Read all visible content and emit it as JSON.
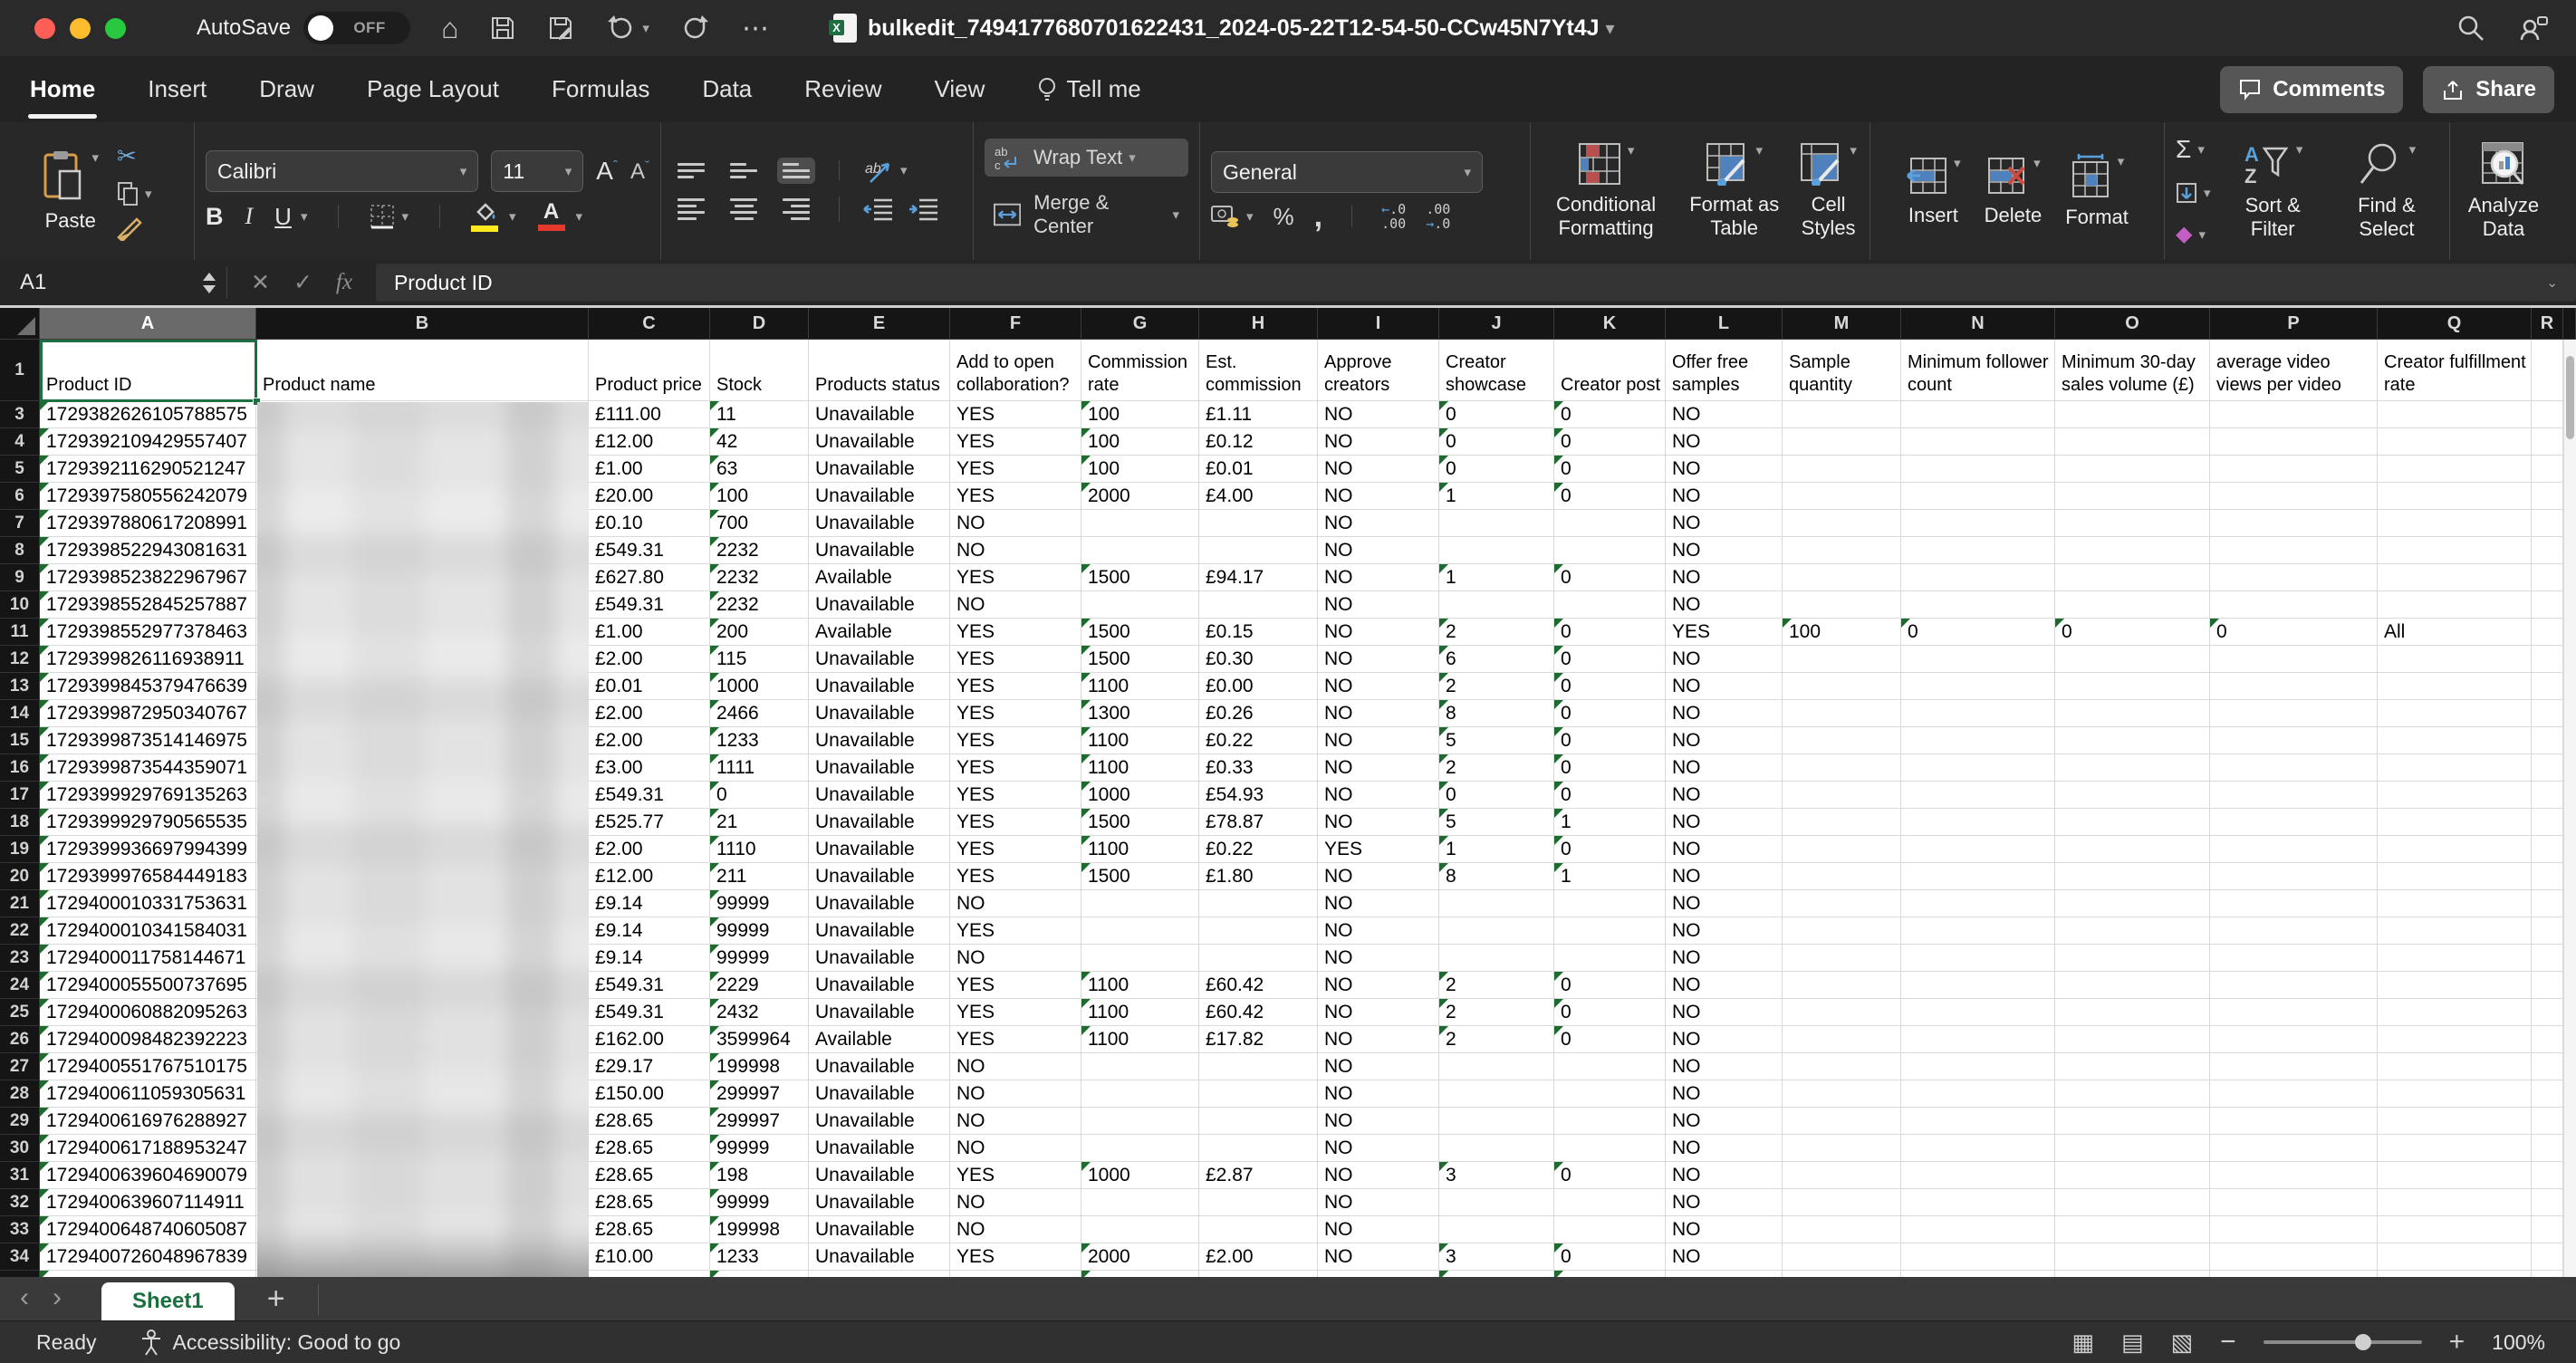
{
  "titlebar": {
    "autosave_label": "AutoSave",
    "autosave_state": "OFF",
    "filename": "bulkedit_7494177680701622431_2024-05-22T12-54-50-CCw45N7Yt4J"
  },
  "tabs": [
    {
      "label": "Home"
    },
    {
      "label": "Insert"
    },
    {
      "label": "Draw"
    },
    {
      "label": "Page Layout"
    },
    {
      "label": "Formulas"
    },
    {
      "label": "Data"
    },
    {
      "label": "Review"
    },
    {
      "label": "View"
    },
    {
      "label": "Tell me"
    }
  ],
  "actions": {
    "comments": "Comments",
    "share": "Share"
  },
  "ribbon": {
    "paste": "Paste",
    "font_name": "Calibri",
    "font_size": "11",
    "wrap_text": "Wrap Text",
    "merge_center": "Merge & Center",
    "number_format": "General",
    "conditional_formatting": "Conditional Formatting",
    "format_as_table": "Format as Table",
    "cell_styles": "Cell Styles",
    "insert": "Insert",
    "delete": "Delete",
    "format": "Format",
    "sort_filter": "Sort & Filter",
    "find_select": "Find & Select",
    "analyze_data": "Analyze Data"
  },
  "formula_bar": {
    "name_box": "A1",
    "content": "Product ID"
  },
  "sheet": {
    "selected_cell": "A1",
    "column_letters": [
      "A",
      "B",
      "C",
      "D",
      "E",
      "F",
      "G",
      "H",
      "I",
      "J",
      "K",
      "L",
      "M",
      "N",
      "O",
      "P",
      "Q",
      "R"
    ],
    "header_row_number": "1",
    "headers": [
      "Product ID",
      "Product name",
      "Product price",
      "Stock",
      "Products status",
      "Add to open collaboration?",
      "Commission rate",
      "Est. commission",
      "Approve creators",
      "Creator showcase",
      "Creator post",
      "Offer free samples",
      "Sample quantity",
      "Minimum follower count",
      "Minimum 30-day sales volume (£)",
      "average video views per video",
      "Creator fulfillment rate"
    ],
    "rows": [
      {
        "n": "3",
        "cells": [
          "1729382626105788575",
          "",
          "£111.00",
          "11",
          "Unavailable",
          "YES",
          "100",
          "£1.11",
          "NO",
          "0",
          "0",
          "NO",
          "",
          "",
          "",
          "",
          ""
        ]
      },
      {
        "n": "4",
        "cells": [
          "1729392109429557407",
          "",
          "£12.00",
          "42",
          "Unavailable",
          "YES",
          "100",
          "£0.12",
          "NO",
          "0",
          "0",
          "NO",
          "",
          "",
          "",
          "",
          ""
        ]
      },
      {
        "n": "5",
        "cells": [
          "1729392116290521247",
          "",
          "£1.00",
          "63",
          "Unavailable",
          "YES",
          "100",
          "£0.01",
          "NO",
          "0",
          "0",
          "NO",
          "",
          "",
          "",
          "",
          ""
        ]
      },
      {
        "n": "6",
        "cells": [
          "1729397580556242079",
          "",
          "£20.00",
          "100",
          "Unavailable",
          "YES",
          "2000",
          "£4.00",
          "NO",
          "1",
          "0",
          "NO",
          "",
          "",
          "",
          "",
          ""
        ]
      },
      {
        "n": "7",
        "cells": [
          "1729397880617208991",
          "",
          "£0.10",
          "700",
          "Unavailable",
          "NO",
          "",
          "",
          "NO",
          "",
          "",
          "NO",
          "",
          "",
          "",
          "",
          ""
        ]
      },
      {
        "n": "8",
        "cells": [
          "1729398522943081631",
          "",
          "£549.31",
          "2232",
          "Unavailable",
          "NO",
          "",
          "",
          "NO",
          "",
          "",
          "NO",
          "",
          "",
          "",
          "",
          ""
        ]
      },
      {
        "n": "9",
        "cells": [
          "1729398523822967967",
          "",
          "£627.80",
          "2232",
          "Available",
          "YES",
          "1500",
          "£94.17",
          "NO",
          "1",
          "0",
          "NO",
          "",
          "",
          "",
          "",
          ""
        ]
      },
      {
        "n": "10",
        "cells": [
          "1729398552845257887",
          "",
          "£549.31",
          "2232",
          "Unavailable",
          "NO",
          "",
          "",
          "NO",
          "",
          "",
          "NO",
          "",
          "",
          "",
          "",
          ""
        ]
      },
      {
        "n": "11",
        "cells": [
          "1729398552977378463",
          "",
          "£1.00",
          "200",
          "Available",
          "YES",
          "1500",
          "£0.15",
          "NO",
          "2",
          "0",
          "YES",
          "100",
          "0",
          "0",
          "0",
          "All"
        ]
      },
      {
        "n": "12",
        "cells": [
          "1729399826116938911",
          "",
          "£2.00",
          "115",
          "Unavailable",
          "YES",
          "1500",
          "£0.30",
          "NO",
          "6",
          "0",
          "NO",
          "",
          "",
          "",
          "",
          ""
        ]
      },
      {
        "n": "13",
        "cells": [
          "1729399845379476639",
          "",
          "£0.01",
          "1000",
          "Unavailable",
          "YES",
          "1100",
          "£0.00",
          "NO",
          "2",
          "0",
          "NO",
          "",
          "",
          "",
          "",
          ""
        ]
      },
      {
        "n": "14",
        "cells": [
          "1729399872950340767",
          "",
          "£2.00",
          "2466",
          "Unavailable",
          "YES",
          "1300",
          "£0.26",
          "NO",
          "8",
          "0",
          "NO",
          "",
          "",
          "",
          "",
          ""
        ]
      },
      {
        "n": "15",
        "cells": [
          "1729399873514146975",
          "",
          "£2.00",
          "1233",
          "Unavailable",
          "YES",
          "1100",
          "£0.22",
          "NO",
          "5",
          "0",
          "NO",
          "",
          "",
          "",
          "",
          ""
        ]
      },
      {
        "n": "16",
        "cells": [
          "1729399873544359071",
          "",
          "£3.00",
          "1111",
          "Unavailable",
          "YES",
          "1100",
          "£0.33",
          "NO",
          "2",
          "0",
          "NO",
          "",
          "",
          "",
          "",
          ""
        ]
      },
      {
        "n": "17",
        "cells": [
          "1729399929769135263",
          "",
          "£549.31",
          "0",
          "Unavailable",
          "YES",
          "1000",
          "£54.93",
          "NO",
          "0",
          "0",
          "NO",
          "",
          "",
          "",
          "",
          ""
        ]
      },
      {
        "n": "18",
        "cells": [
          "1729399929790565535",
          "",
          "£525.77",
          "21",
          "Unavailable",
          "YES",
          "1500",
          "£78.87",
          "NO",
          "5",
          "1",
          "NO",
          "",
          "",
          "",
          "",
          ""
        ]
      },
      {
        "n": "19",
        "cells": [
          "1729399936697994399",
          "",
          "£2.00",
          "1110",
          "Unavailable",
          "YES",
          "1100",
          "£0.22",
          "YES",
          "1",
          "0",
          "NO",
          "",
          "",
          "",
          "",
          ""
        ]
      },
      {
        "n": "20",
        "cells": [
          "1729399976584449183",
          "",
          "£12.00",
          "211",
          "Unavailable",
          "YES",
          "1500",
          "£1.80",
          "NO",
          "8",
          "1",
          "NO",
          "",
          "",
          "",
          "",
          ""
        ]
      },
      {
        "n": "21",
        "cells": [
          "1729400010331753631",
          "",
          "£9.14",
          "99999",
          "Unavailable",
          "NO",
          "",
          "",
          "NO",
          "",
          "",
          "NO",
          "",
          "",
          "",
          "",
          ""
        ]
      },
      {
        "n": "22",
        "cells": [
          "1729400010341584031",
          "",
          "£9.14",
          "99999",
          "Unavailable",
          "YES",
          "",
          "",
          "NO",
          "",
          "",
          "NO",
          "",
          "",
          "",
          "",
          ""
        ]
      },
      {
        "n": "23",
        "cells": [
          "1729400011758144671",
          "",
          "£9.14",
          "99999",
          "Unavailable",
          "NO",
          "",
          "",
          "NO",
          "",
          "",
          "NO",
          "",
          "",
          "",
          "",
          ""
        ]
      },
      {
        "n": "24",
        "cells": [
          "1729400055500737695",
          "",
          "£549.31",
          "2229",
          "Unavailable",
          "YES",
          "1100",
          "£60.42",
          "NO",
          "2",
          "0",
          "NO",
          "",
          "",
          "",
          "",
          ""
        ]
      },
      {
        "n": "25",
        "cells": [
          "1729400060882095263",
          "",
          "£549.31",
          "2432",
          "Unavailable",
          "YES",
          "1100",
          "£60.42",
          "NO",
          "2",
          "0",
          "NO",
          "",
          "",
          "",
          "",
          ""
        ]
      },
      {
        "n": "26",
        "cells": [
          "1729400098482392223",
          "",
          "£162.00",
          "3599964",
          "Available",
          "YES",
          "1100",
          "£17.82",
          "NO",
          "2",
          "0",
          "NO",
          "",
          "",
          "",
          "",
          ""
        ]
      },
      {
        "n": "27",
        "cells": [
          "1729400551767510175",
          "",
          "£29.17",
          "199998",
          "Unavailable",
          "NO",
          "",
          "",
          "NO",
          "",
          "",
          "NO",
          "",
          "",
          "",
          "",
          ""
        ]
      },
      {
        "n": "28",
        "cells": [
          "1729400611059305631",
          "",
          "£150.00",
          "299997",
          "Unavailable",
          "NO",
          "",
          "",
          "NO",
          "",
          "",
          "NO",
          "",
          "",
          "",
          "",
          ""
        ]
      },
      {
        "n": "29",
        "cells": [
          "1729400616976288927",
          "",
          "£28.65",
          "299997",
          "Unavailable",
          "NO",
          "",
          "",
          "NO",
          "",
          "",
          "NO",
          "",
          "",
          "",
          "",
          ""
        ]
      },
      {
        "n": "30",
        "cells": [
          "1729400617188953247",
          "",
          "£28.65",
          "99999",
          "Unavailable",
          "NO",
          "",
          "",
          "NO",
          "",
          "",
          "NO",
          "",
          "",
          "",
          "",
          ""
        ]
      },
      {
        "n": "31",
        "cells": [
          "1729400639604690079",
          "",
          "£28.65",
          "198",
          "Unavailable",
          "YES",
          "1000",
          "£2.87",
          "NO",
          "3",
          "0",
          "NO",
          "",
          "",
          "",
          "",
          ""
        ]
      },
      {
        "n": "32",
        "cells": [
          "1729400639607114911",
          "",
          "£28.65",
          "99999",
          "Unavailable",
          "NO",
          "",
          "",
          "NO",
          "",
          "",
          "NO",
          "",
          "",
          "",
          "",
          ""
        ]
      },
      {
        "n": "33",
        "cells": [
          "1729400648740605087",
          "",
          "£28.65",
          "199998",
          "Unavailable",
          "NO",
          "",
          "",
          "NO",
          "",
          "",
          "NO",
          "",
          "",
          "",
          "",
          ""
        ]
      },
      {
        "n": "34",
        "cells": [
          "1729400726048967839",
          "",
          "£10.00",
          "1233",
          "Unavailable",
          "YES",
          "2000",
          "£2.00",
          "NO",
          "3",
          "0",
          "NO",
          "",
          "",
          "",
          "",
          ""
        ]
      }
    ]
  },
  "sheet_tabs": {
    "active": "Sheet1"
  },
  "status_bar": {
    "mode": "Ready",
    "accessibility": "Accessibility: Good to go",
    "zoom": "100%"
  }
}
